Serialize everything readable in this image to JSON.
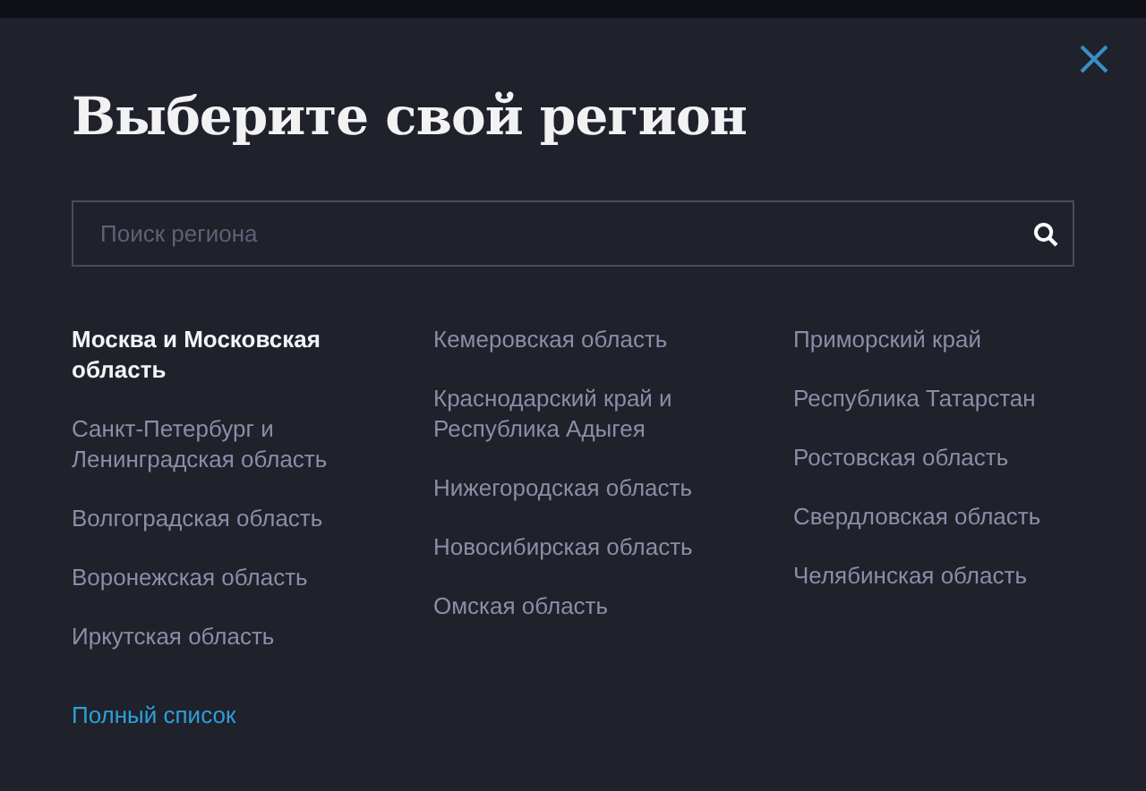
{
  "dialog": {
    "title": "Выберите свой регион",
    "search": {
      "placeholder": "Поиск региона"
    },
    "columns": [
      [
        {
          "name": "Москва и Московская область",
          "selected": true
        },
        {
          "name": "Санкт-Петербург и Ленинградская область",
          "selected": false
        },
        {
          "name": "Волгоградская область",
          "selected": false
        },
        {
          "name": "Воронежская область",
          "selected": false
        },
        {
          "name": "Иркутская область",
          "selected": false
        }
      ],
      [
        {
          "name": "Кемеровская область",
          "selected": false
        },
        {
          "name": "Краснодарский край и Республика Адыгея",
          "selected": false
        },
        {
          "name": "Нижегородская область",
          "selected": false
        },
        {
          "name": "Новосибирская область",
          "selected": false
        },
        {
          "name": "Омская область",
          "selected": false
        }
      ],
      [
        {
          "name": "Приморский край",
          "selected": false
        },
        {
          "name": "Республика Татарстан",
          "selected": false
        },
        {
          "name": "Ростовская область",
          "selected": false
        },
        {
          "name": "Свердловская область",
          "selected": false
        },
        {
          "name": "Челябинская область",
          "selected": false
        }
      ]
    ],
    "full_list_link": "Полный список"
  }
}
